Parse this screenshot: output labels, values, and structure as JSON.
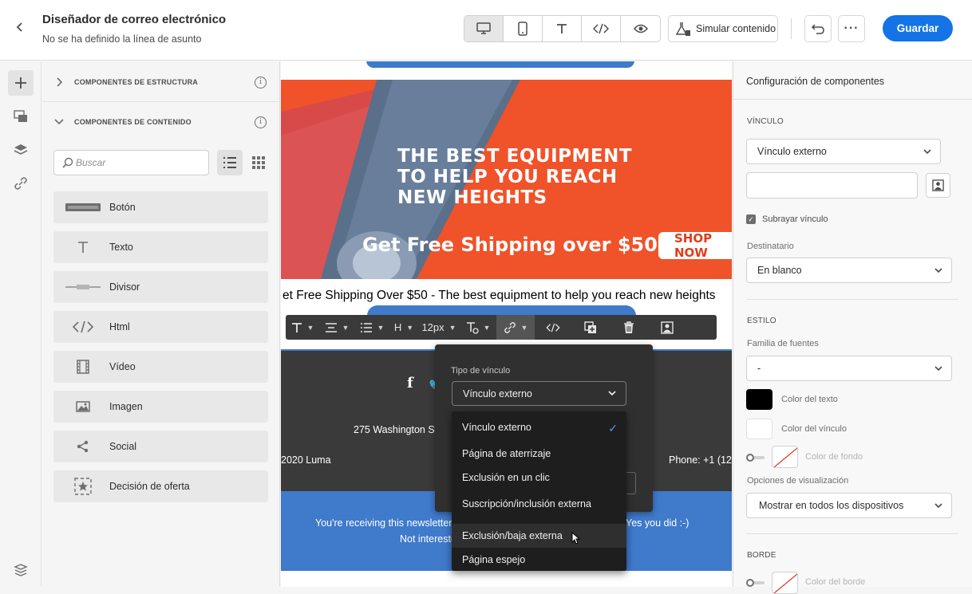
{
  "header": {
    "title": "Diseñador de correo electrónico",
    "subtitle": "No se ha definido la línea de asunto",
    "simulate_label": "Simular contenido",
    "save_label": "Guardar"
  },
  "components": {
    "structure_label": "COMPONENTES DE ESTRUCTURA",
    "content_label": "COMPONENTES DE CONTENIDO",
    "search_placeholder": "Buscar",
    "items": [
      {
        "label": "Botón",
        "icon": "button-icon"
      },
      {
        "label": "Texto",
        "icon": "text-icon"
      },
      {
        "label": "Divisor",
        "icon": "divider-icon"
      },
      {
        "label": "Html",
        "icon": "html-icon"
      },
      {
        "label": "Vídeo",
        "icon": "video-icon"
      },
      {
        "label": "Imagen",
        "icon": "image-icon"
      },
      {
        "label": "Social",
        "icon": "share-icon"
      },
      {
        "label": "Decisión de oferta",
        "icon": "offer-decision-icon"
      }
    ]
  },
  "canvas": {
    "banner_line1": "THE BEST EQUIPMENT",
    "banner_line2": "TO HELP YOU REACH",
    "banner_line3": "NEW HEIGHTS",
    "banner_shipping": "Get Free Shipping over $50",
    "banner_shop": "SHOP NOW",
    "preheader": "et Free Shipping Over $50 - The best equipment to help you reach new heights",
    "address": "275 Washington St",
    "copyright": "2020 Luma",
    "phone": "Phone: +1 (123",
    "newsletter_left": "You're receiving this newsletter b",
    "newsletter_right": "Yes you did :-)",
    "not_interested": "Not intereste"
  },
  "toolbar": {
    "heading_label": "H",
    "font_size": "12px"
  },
  "link_popover": {
    "type_label": "Tipo de vínculo",
    "selected": "Vínculo externo",
    "options": [
      "Vínculo externo",
      "Página de aterrizaje",
      "Exclusión en un clic",
      "Suscripción/inclusión externa",
      "Exclusión/baja externa",
      "Página espejo"
    ]
  },
  "settings": {
    "title": "Configuración de componentes",
    "link_section": "VÍNCULO",
    "link_type": "Vínculo externo",
    "underline_label": "Subrayar vínculo",
    "target_label": "Destinatario",
    "target_value": "En blanco",
    "style_section": "ESTILO",
    "font_family_label": "Familia de fuentes",
    "font_family_value": "-",
    "text_color_label": "Color del texto",
    "text_color": "#000000",
    "link_color_label": "Color del vínculo",
    "link_color": "#ffffff",
    "bg_color_label": "Color de fondo",
    "display_label": "Opciones de visualización",
    "display_value": "Mostrar en todos los dispositivos",
    "border_section": "BORDE",
    "border_color_label": "Color del borde"
  },
  "colors": {
    "accent": "#1473e6",
    "banner_orange": "#f0522a",
    "email_blue": "#3f7acb",
    "footer_dark": "#3a3a3a"
  }
}
